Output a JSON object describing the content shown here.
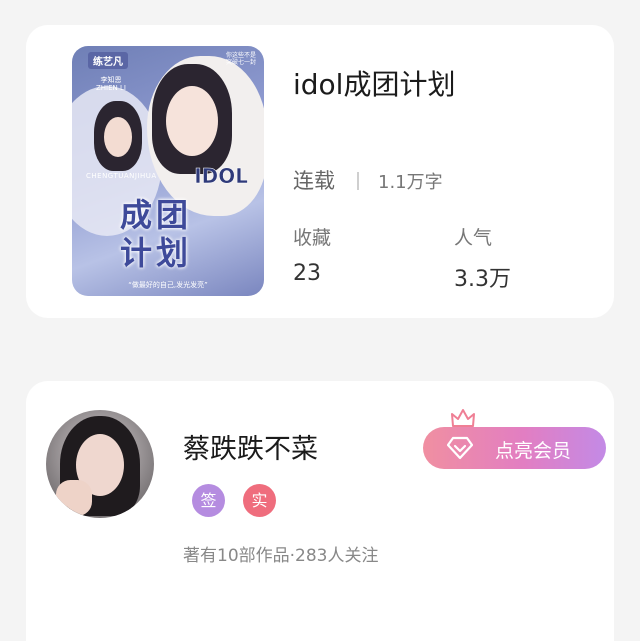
{
  "book": {
    "title": "idol成团计划",
    "status": "连载",
    "word_count": "1.1万字",
    "favorites_label": "收藏",
    "favorites_value": "23",
    "popularity_label": "人气",
    "popularity_value": "3.3万",
    "cover": {
      "brand_tag": "练艺凡",
      "names": "李知恩\nZHIEN LI",
      "side_text": "你这些不是\n突破七一封",
      "roman": "CHENGTUANJIHUA",
      "idol_word": "IDOL",
      "big_title": "成团计划",
      "slogan": "“做最好的自己,发光发亮”"
    }
  },
  "author": {
    "name": "蔡跌跌不菜",
    "badge_signed": "签",
    "badge_real": "实",
    "meta": "著有10部作品·283人关注",
    "vip_button": "点亮会员"
  },
  "icons": {
    "vip": "diamond-icon",
    "crown": "crown-icon"
  },
  "colors": {
    "vip_gradient_start": "#f08fa1",
    "vip_gradient_end": "#c38ae6",
    "badge_signed": "#b58ce0",
    "badge_real": "#ef6d7d"
  }
}
